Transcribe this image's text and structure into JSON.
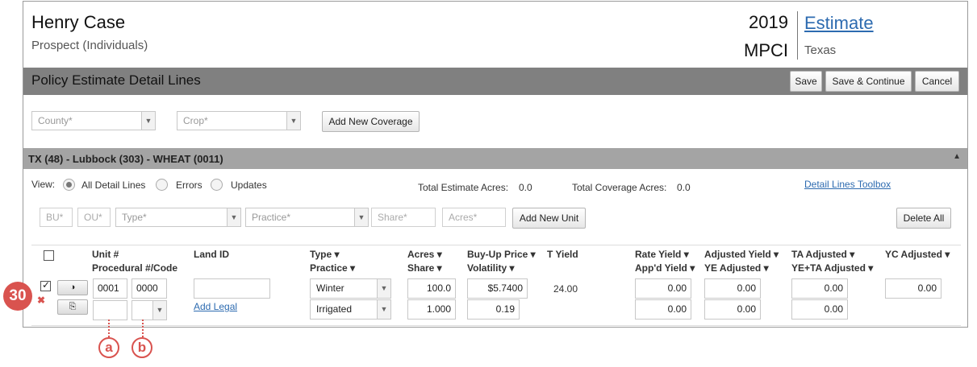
{
  "header": {
    "name": "Henry Case",
    "subtitle": "Prospect (Individuals)",
    "year": "2019",
    "plan": "MPCI",
    "estimate_link": "Estimate",
    "state": "Texas"
  },
  "policy_bar": {
    "title": "Policy Estimate Detail Lines",
    "save": "Save",
    "save_continue": "Save & Continue",
    "cancel": "Cancel"
  },
  "coverage_form": {
    "county_placeholder": "County*",
    "crop_placeholder": "Crop*",
    "add_coverage": "Add New Coverage"
  },
  "section": {
    "title": "TX (48) - Lubbock (303) - WHEAT (0011)",
    "collapse_icon": "triangle-up-icon"
  },
  "view": {
    "label": "View:",
    "options": [
      "All Detail Lines",
      "Errors",
      "Updates"
    ],
    "selected": "All Detail Lines",
    "total_estimate_label": "Total Estimate Acres:",
    "total_estimate_value": "0.0",
    "total_coverage_label": "Total Coverage Acres:",
    "total_coverage_value": "0.0",
    "toolbox_link": "Detail Lines Toolbox"
  },
  "unit_form": {
    "bu": "BU*",
    "ou": "OU*",
    "type": "Type*",
    "practice": "Practice*",
    "share": "Share*",
    "acres": "Acres*",
    "add_unit": "Add New Unit",
    "delete_all": "Delete All"
  },
  "table": {
    "headers": {
      "unit": "Unit #",
      "procedural": "Procedural #/Code",
      "land_id": "Land ID",
      "type": "Type ▾",
      "practice": "Practice ▾",
      "acres": "Acres ▾",
      "share": "Share ▾",
      "buyup": "Buy-Up Price ▾",
      "volatility": "Volatility ▾",
      "tyield": "T Yield",
      "rate_yield": "Rate Yield ▾",
      "appd_yield": "App'd Yield ▾",
      "adj_yield": "Adjusted Yield ▾",
      "ye_adj": "YE Adjusted ▾",
      "ta_adj": "TA Adjusted ▾",
      "yeta_adj": "YE+TA Adjusted ▾",
      "yc_adj": "YC Adjusted ▾"
    },
    "row": {
      "unit": "0001",
      "procedural": "0000",
      "land_id": "",
      "add_legal": "Add Legal",
      "type": "Winter",
      "practice": "Irrigated",
      "acres": "100.0",
      "share": "1.000",
      "buyup": "$5.7400",
      "volatility": "0.19",
      "tyield": "24.00",
      "rate_yield": "0.00",
      "appd_yield": "0.00",
      "adj_yield": "0.00",
      "ye_adj": "0.00",
      "ta_adj": "0.00",
      "yeta_adj": "0.00",
      "yc_adj": "0.00",
      "contrast_icon": "◑",
      "copy_icon": "⎘"
    }
  },
  "annotations": {
    "badge": "30",
    "error_mark": "✖",
    "callout_a": "a",
    "callout_b": "b",
    "accent": "#d9534f"
  },
  "colors": {
    "link": "#2d6bb0",
    "header_bar": "#808080",
    "section_bar": "#a4a4a4"
  }
}
